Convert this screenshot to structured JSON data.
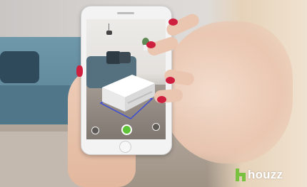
{
  "brand": {
    "logo_text": "houzz",
    "logo_mark_color": "#7ac142",
    "logo_text_color": "#ffffff"
  },
  "phone_ui": {
    "capture_button_color": "#5fc33a",
    "nail_polish_color": "#cf1f3f"
  }
}
